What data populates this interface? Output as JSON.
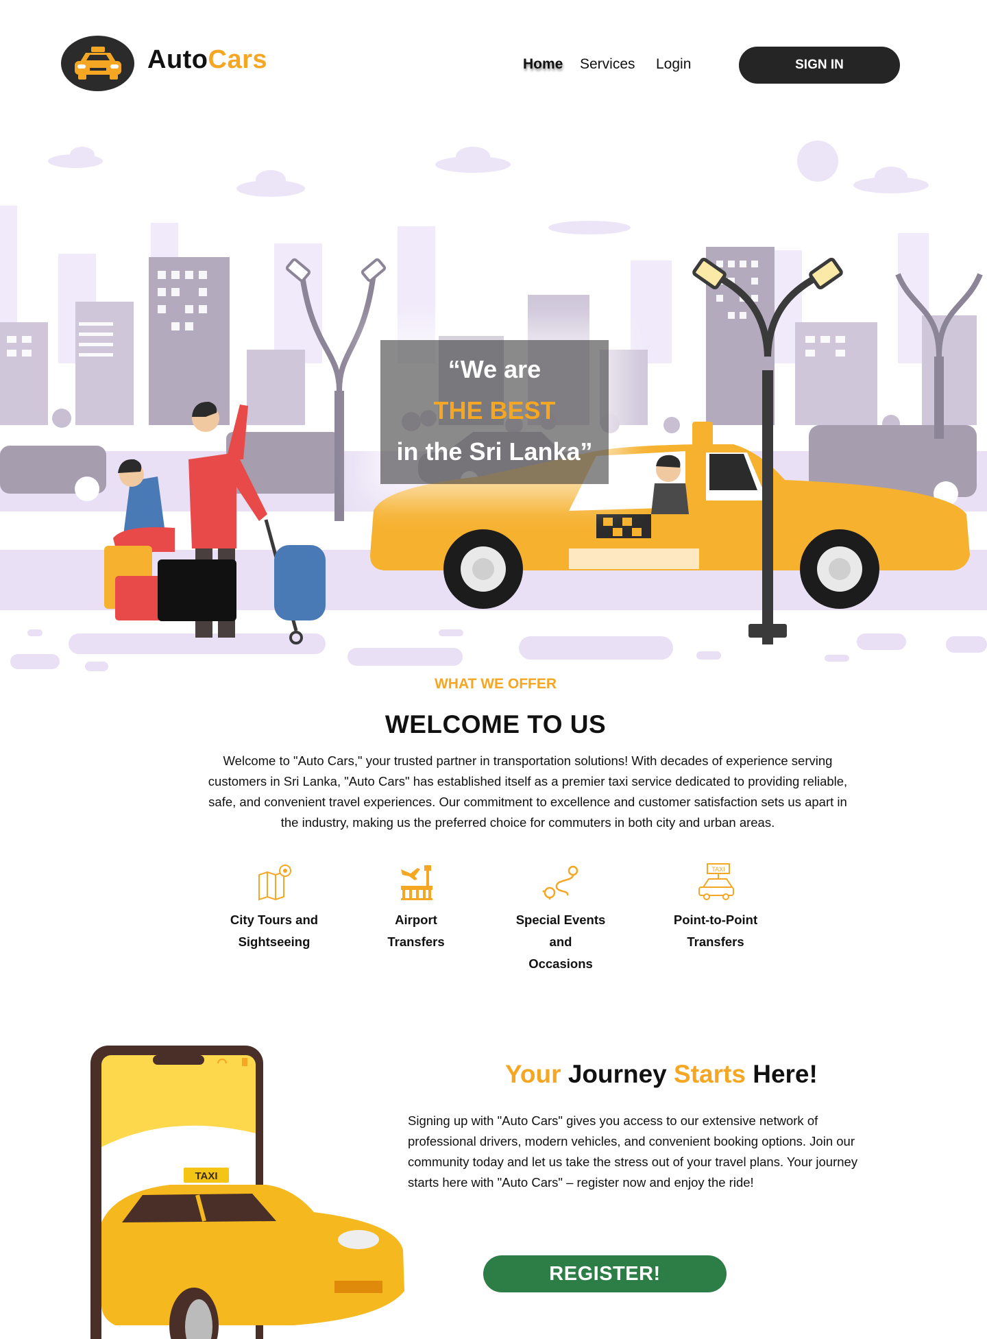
{
  "header": {
    "brand_part1": "Auto",
    "brand_part2": "Cars",
    "logo_icon": "taxi-car-icon",
    "nav": [
      {
        "label": "Home",
        "active": true
      },
      {
        "label": "Services",
        "active": false
      },
      {
        "label": "Login",
        "active": false
      }
    ],
    "signin_label": "SIGN IN"
  },
  "hero": {
    "quote_line1": "“We are",
    "quote_line2": "THE BEST",
    "quote_line3": "in the Sri Lanka”"
  },
  "offer": {
    "eyebrow": "WHAT WE OFFER",
    "title": "WELCOME TO US",
    "text": "Welcome to \"Auto Cars,\" your trusted partner in transportation solutions! With decades of experience serving customers in Sri Lanka, \"Auto Cars\" has established itself as a premier taxi service dedicated to providing reliable, safe, and convenient travel experiences. Our commitment to excellence and customer satisfaction sets us apart in the industry, making us the preferred choice for commuters in both city and urban areas.",
    "services": [
      {
        "line1": "City Tours and",
        "line2": "Sightseeing",
        "line3": "",
        "icon": "map-pin-icon"
      },
      {
        "line1": "Airport",
        "line2": "Transfers",
        "line3": "",
        "icon": "airport-icon"
      },
      {
        "line1": "Special Events",
        "line2": "and",
        "line3": "Occasions",
        "icon": "route-icon"
      },
      {
        "line1": "Point-to-Point",
        "line2": "Transfers",
        "line3": "",
        "icon": "taxi-sign-icon"
      }
    ]
  },
  "journey": {
    "title_part1": "Your",
    "title_part2": "Journey",
    "title_part3": "Starts",
    "title_part4": "Here!",
    "text": "Signing up with \"Auto Cars\" gives you access to our extensive network of professional drivers, modern vehicles, and convenient booking options. Join our community today and let us take the stress out of your travel plans. Your journey starts here with \"Auto Cars\" – register now and enjoy the ride!",
    "register_label": "REGISTER!",
    "phone_taxi_sign": "TAXI"
  },
  "colors": {
    "accent": "#f5a623",
    "dark": "#252525",
    "register_green": "#2d7d46",
    "city_lavender": "#e9e0f5"
  }
}
